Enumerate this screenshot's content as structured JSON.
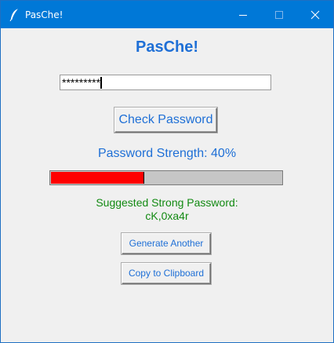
{
  "window": {
    "title": "PasChe!"
  },
  "app": {
    "heading": "PasChe!",
    "password_value": "*********",
    "check_button_label": "Check Password",
    "strength_label": "Password Strength: 40%",
    "strength_percent": 40,
    "suggest_label": "Suggested Strong Password:",
    "suggested_password": "cK,0xa4r",
    "generate_button_label": "Generate Another",
    "copy_button_label": "Copy to Clipboard"
  },
  "icons": {
    "app": "feather-icon",
    "minimize": "minimize-icon",
    "maximize": "maximize-icon",
    "close": "close-icon"
  },
  "colors": {
    "titlebar": "#0078d7",
    "accent": "#1e6fd6",
    "strength_fill": "#ff0000",
    "suggestion_text": "#128a12",
    "window_bg": "#f0f0f0"
  }
}
